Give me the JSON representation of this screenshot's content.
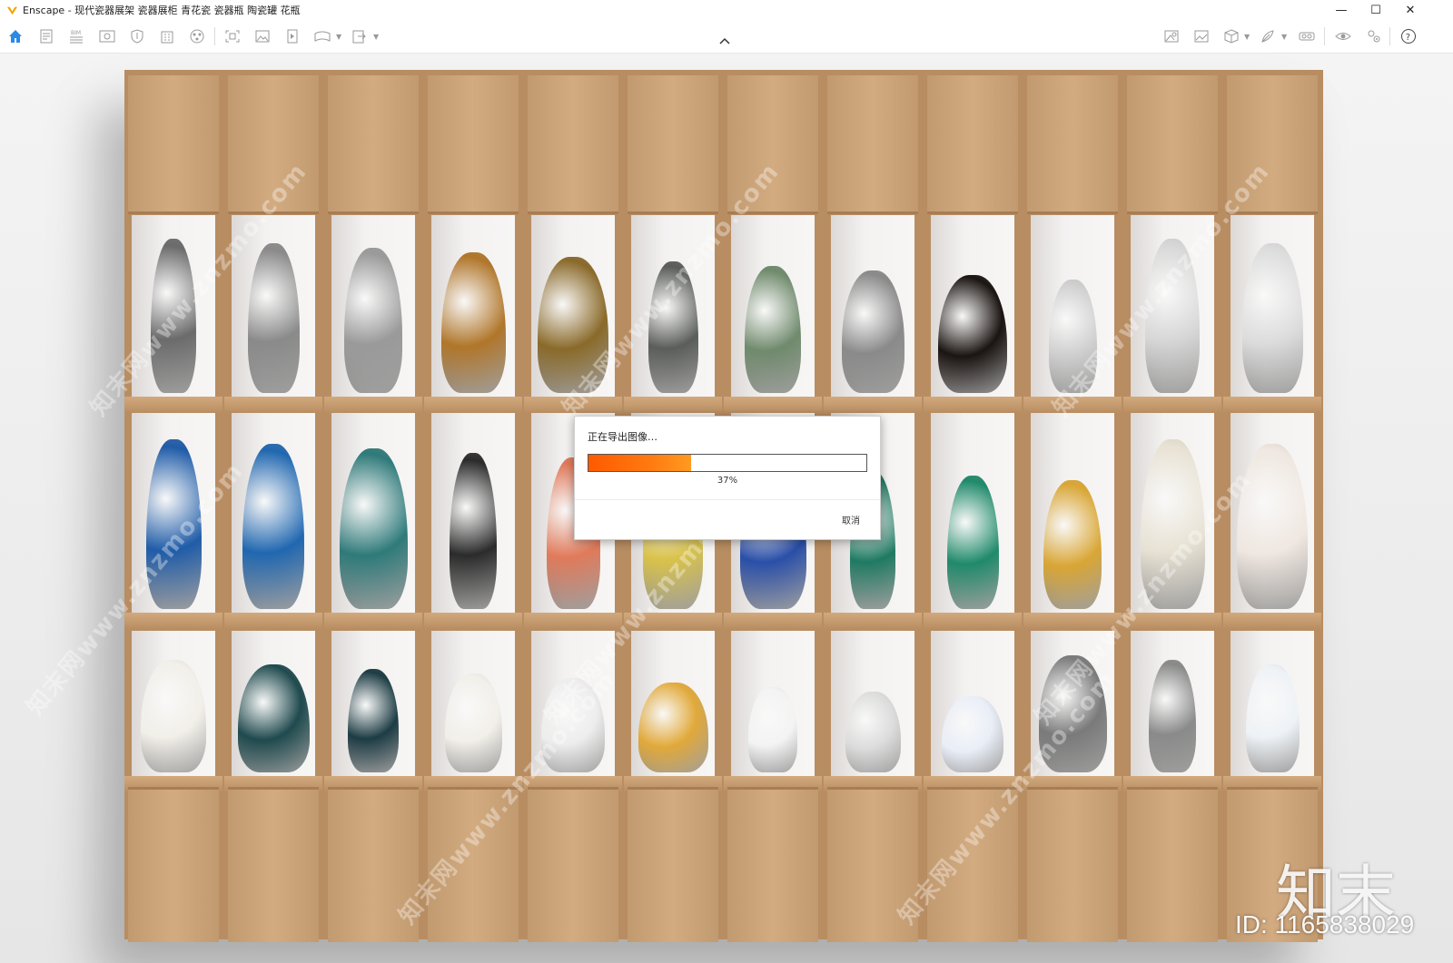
{
  "window": {
    "title": "Enscape - 现代瓷器展架 瓷器展柜 青花瓷 瓷器瓶 陶瓷罐 花瓶",
    "controls": [
      "minimize",
      "maximize",
      "close"
    ]
  },
  "toolbar": {
    "left_icons": [
      "home-icon",
      "document-icon",
      "bim-icon",
      "view-icon",
      "shield-icon",
      "building-icon",
      "material-icon",
      "screenshot-icon",
      "image-icon",
      "video-path-icon",
      "panorama-icon",
      "export-icon"
    ],
    "right_icons": [
      "asset-library-icon",
      "image-gallery-icon",
      "cube-icon",
      "feather-icon",
      "vr-icon",
      "visibility-icon",
      "settings-icon",
      "help-icon"
    ]
  },
  "dialog": {
    "title": "正在导出图像…",
    "progress": 0.37,
    "progress_label": "37%",
    "cancel_label": "取消",
    "accent": "#ff6a00"
  },
  "watermark": {
    "text": "知末网www.znzmo.com",
    "logo_text": "知末",
    "id_text": "ID: 1165838029"
  }
}
